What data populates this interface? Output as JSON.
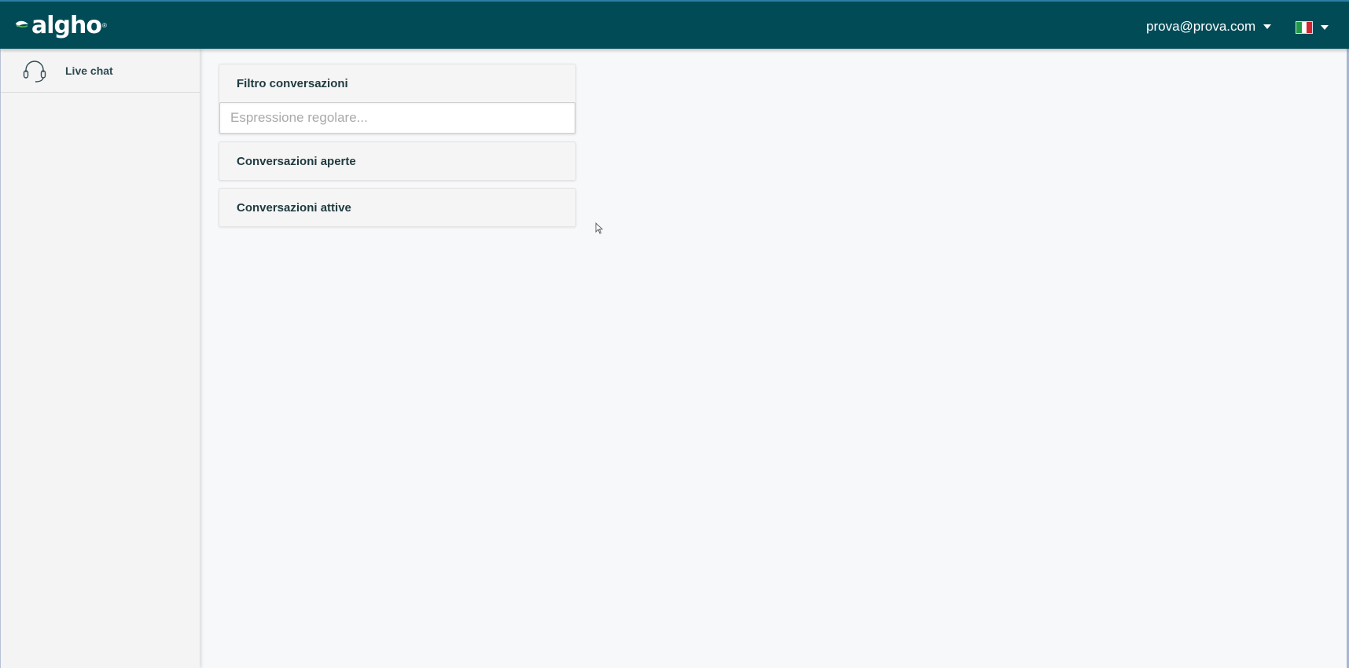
{
  "app": {
    "logo_text": "algho",
    "logo_mark": "®",
    "brand_color": "#014b57",
    "accent_color": "#5bb35b"
  },
  "header": {
    "user_email": "prova@prova.com",
    "language_flag": "italy-flag-icon"
  },
  "sidebar": {
    "items": [
      {
        "icon": "headset-icon",
        "label": "Live chat"
      }
    ]
  },
  "main": {
    "filter": {
      "title": "Filtro conversazioni",
      "placeholder": "Espressione regolare..."
    },
    "sections": [
      {
        "title": "Conversazioni aperte"
      },
      {
        "title": "Conversazioni attive"
      }
    ]
  }
}
